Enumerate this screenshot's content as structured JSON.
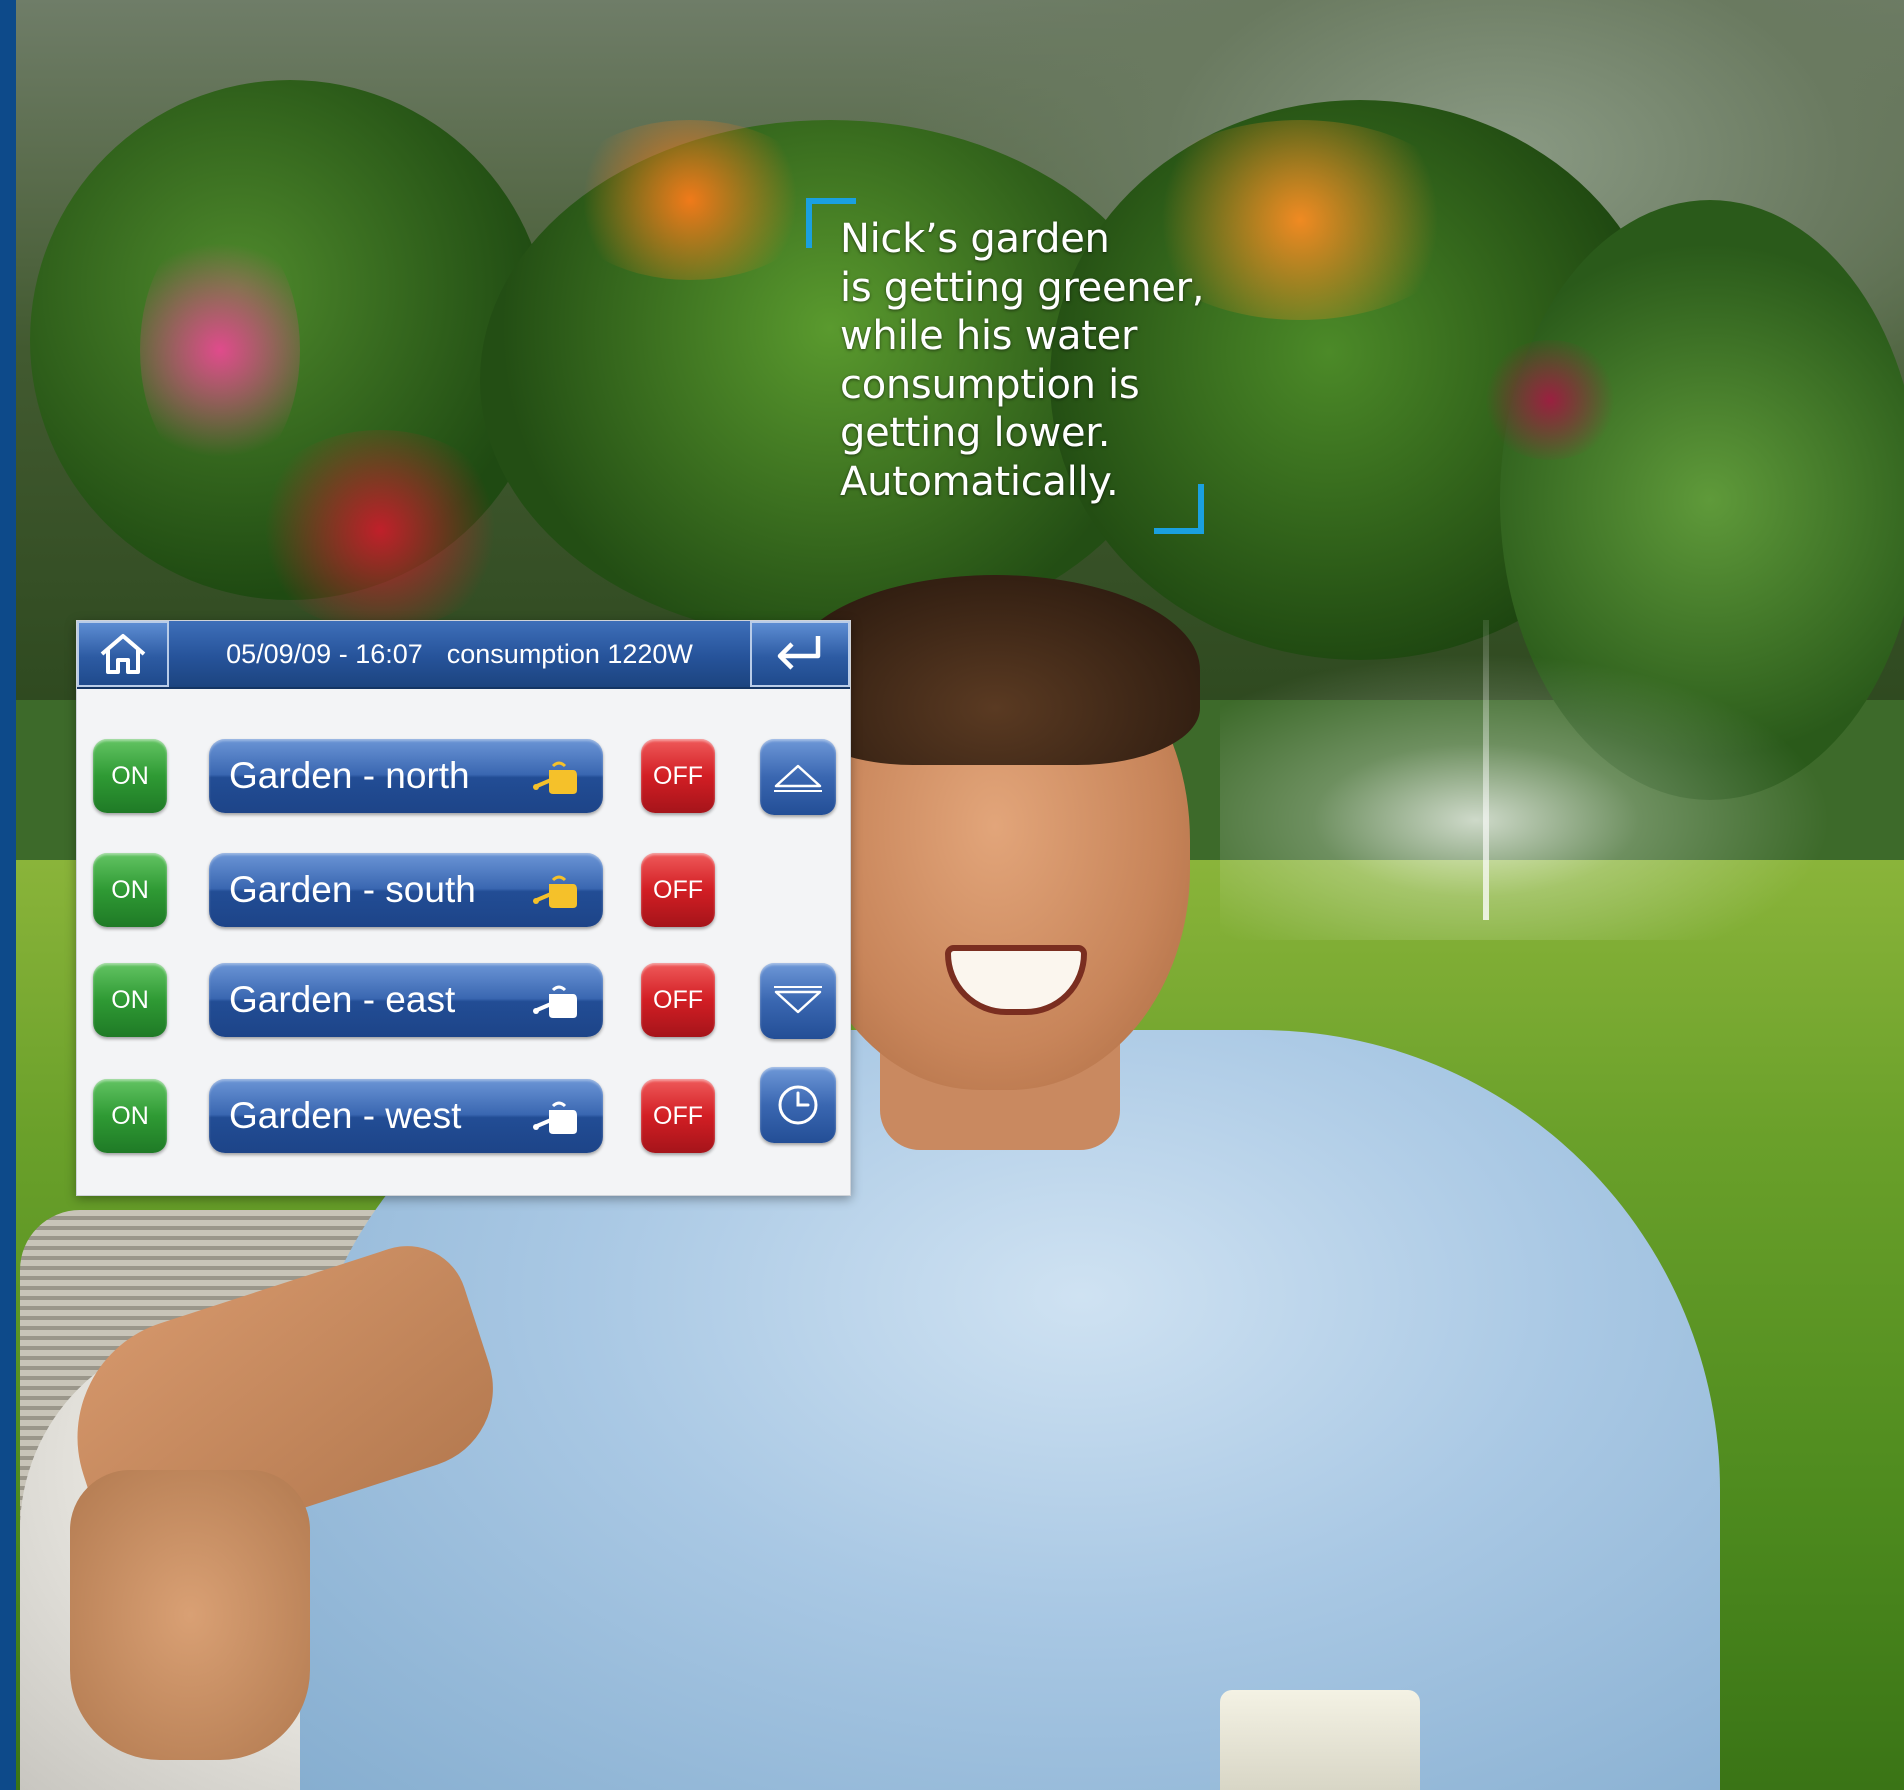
{
  "headline": {
    "lines": [
      "Nick’s garden",
      "is getting greener,",
      "while his water",
      "consumption is",
      "getting lower.",
      "Automatically."
    ],
    "bracket_color": "#1aa0e0"
  },
  "panel": {
    "home_icon": "home-icon",
    "back_icon": "return-arrow-icon",
    "date_time": "05/09/09 - 16:07",
    "consumption": "consumption 1220W",
    "rows": [
      {
        "on_label": "ON",
        "zone_label": "Garden - north",
        "zone_icon": "watering-can-icon",
        "zone_icon_active": true,
        "off_label": "OFF"
      },
      {
        "on_label": "ON",
        "zone_label": "Garden - south",
        "zone_icon": "watering-can-icon",
        "zone_icon_active": true,
        "off_label": "OFF"
      },
      {
        "on_label": "ON",
        "zone_label": "Garden - east",
        "zone_icon": "watering-can-icon",
        "zone_icon_active": false,
        "off_label": "OFF"
      },
      {
        "on_label": "ON",
        "zone_label": "Garden - west",
        "zone_icon": "watering-can-icon",
        "zone_icon_active": false,
        "off_label": "OFF"
      }
    ],
    "side_buttons": {
      "up_icon": "scroll-up-icon",
      "down_icon": "scroll-down-icon",
      "clock_icon": "clock-icon"
    },
    "colors": {
      "on": "#2f9a34",
      "off": "#d21e24",
      "zone": "#2d5ba3",
      "icon_active": "#f5c12a",
      "icon_inactive": "#ffffff"
    }
  }
}
